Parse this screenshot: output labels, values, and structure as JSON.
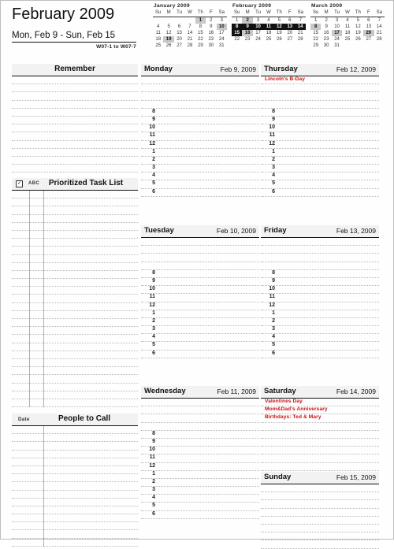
{
  "header": {
    "month_title": "February 2009",
    "date_range": "Mon, Feb 9  -  Sun, Feb 15",
    "week_code": "W07-1 to W07-7"
  },
  "mini_calendars": [
    {
      "title": "January 2009",
      "weekday_headers": [
        "Su",
        "M",
        "Tu",
        "W",
        "Th",
        "F",
        "Sa"
      ],
      "weeks": [
        [
          "",
          "",
          "",
          "",
          "1",
          "2",
          "3"
        ],
        [
          "4",
          "5",
          "6",
          "7",
          "8",
          "9",
          "10"
        ],
        [
          "11",
          "12",
          "13",
          "14",
          "15",
          "16",
          "17"
        ],
        [
          "18",
          "19",
          "20",
          "21",
          "22",
          "23",
          "24"
        ],
        [
          "25",
          "26",
          "27",
          "28",
          "29",
          "30",
          "31"
        ]
      ],
      "highlight_grey": [
        "1",
        "10",
        "19"
      ],
      "highlight_dark": []
    },
    {
      "title": "February 2009",
      "weekday_headers": [
        "Su",
        "M",
        "Tu",
        "W",
        "Th",
        "F",
        "Sa"
      ],
      "weeks": [
        [
          "1",
          "2",
          "3",
          "4",
          "5",
          "6",
          "7"
        ],
        [
          "8",
          "9",
          "10",
          "11",
          "12",
          "13",
          "14"
        ],
        [
          "15",
          "16",
          "17",
          "18",
          "19",
          "20",
          "21"
        ],
        [
          "22",
          "23",
          "24",
          "25",
          "26",
          "27",
          "28"
        ]
      ],
      "highlight_grey": [
        "2",
        "16"
      ],
      "highlight_dark": [
        "8",
        "9",
        "10",
        "11",
        "12",
        "13",
        "14",
        "15"
      ]
    },
    {
      "title": "March 2009",
      "weekday_headers": [
        "Su",
        "M",
        "Tu",
        "W",
        "Th",
        "F",
        "Sa"
      ],
      "weeks": [
        [
          "1",
          "2",
          "3",
          "4",
          "5",
          "6",
          "7"
        ],
        [
          "8",
          "9",
          "10",
          "11",
          "12",
          "13",
          "14"
        ],
        [
          "15",
          "16",
          "17",
          "18",
          "19",
          "20",
          "21"
        ],
        [
          "22",
          "23",
          "24",
          "25",
          "26",
          "27",
          "28"
        ],
        [
          "29",
          "30",
          "31",
          "",
          "",
          "",
          ""
        ]
      ],
      "highlight_grey": [
        "8",
        "17",
        "20"
      ],
      "highlight_dark": []
    }
  ],
  "left_sections": [
    {
      "name": "remember",
      "title": "Remember",
      "icons": [],
      "date_col_label": "",
      "row_count": 14,
      "dividers": []
    },
    {
      "name": "prioritized-task-list",
      "title": "Prioritized Task List",
      "icons": [
        "checkbox-icon"
      ],
      "abc_label": "ABC",
      "row_count": 27,
      "dividers": [
        22,
        40
      ]
    },
    {
      "name": "people-to-call",
      "title": "People to Call",
      "date_col_label": "Date",
      "row_count": 14,
      "dividers": [
        40
      ]
    }
  ],
  "hour_labels": [
    "8",
    "9",
    "10",
    "11",
    "12",
    "1",
    "2",
    "3",
    "4",
    "5",
    "6"
  ],
  "days": [
    {
      "name": "monday",
      "weekday": "Monday",
      "date": "Feb 9, 2009",
      "events": [],
      "blank_rows_before_hours": 4,
      "hours": [
        "8",
        "9",
        "10",
        "11",
        "12",
        "1",
        "2",
        "3",
        "4",
        "5",
        "6"
      ]
    },
    {
      "name": "tuesday",
      "weekday": "Tuesday",
      "date": "Feb 10, 2009",
      "events": [],
      "blank_rows_before_hours": 4,
      "hours": [
        "8",
        "9",
        "10",
        "11",
        "12",
        "1",
        "2",
        "3",
        "4",
        "5",
        "6"
      ]
    },
    {
      "name": "wednesday",
      "weekday": "Wednesday",
      "date": "Feb 11, 2009",
      "events": [],
      "blank_rows_before_hours": 4,
      "hours": [
        "8",
        "9",
        "10",
        "11",
        "12",
        "1",
        "2",
        "3",
        "4",
        "5",
        "6"
      ]
    },
    {
      "name": "thursday",
      "weekday": "Thursday",
      "date": "Feb 12, 2009",
      "events": [
        "Lincoln's B-Day"
      ],
      "blank_rows_before_hours": 4,
      "hours": [
        "8",
        "9",
        "10",
        "11",
        "12",
        "1",
        "2",
        "3",
        "4",
        "5",
        "6"
      ]
    },
    {
      "name": "friday",
      "weekday": "Friday",
      "date": "Feb 13, 2009",
      "events": [],
      "blank_rows_before_hours": 4,
      "hours": [
        "8",
        "9",
        "10",
        "11",
        "12",
        "1",
        "2",
        "3",
        "4",
        "5",
        "6"
      ]
    },
    {
      "name": "saturday",
      "weekday": "Saturday",
      "date": "Feb 14, 2009",
      "events": [
        "Valentines Day",
        "Mom&Dad's Anniversary",
        "Birthdays: Ted & Mary"
      ],
      "blank_rows_before_hours": 0,
      "hours": []
    },
    {
      "name": "sunday",
      "weekday": "Sunday",
      "date": "Feb 15, 2009",
      "events": [],
      "blank_rows_before_hours": 0,
      "hours": []
    }
  ],
  "colors": {
    "event_red": "#d01010",
    "rule_line": "#b9b9b9",
    "header_rule": "#111111",
    "header_fill": "#f2f2f2",
    "highlight_grey": "#c8c8c8",
    "highlight_dark": "#111111"
  }
}
